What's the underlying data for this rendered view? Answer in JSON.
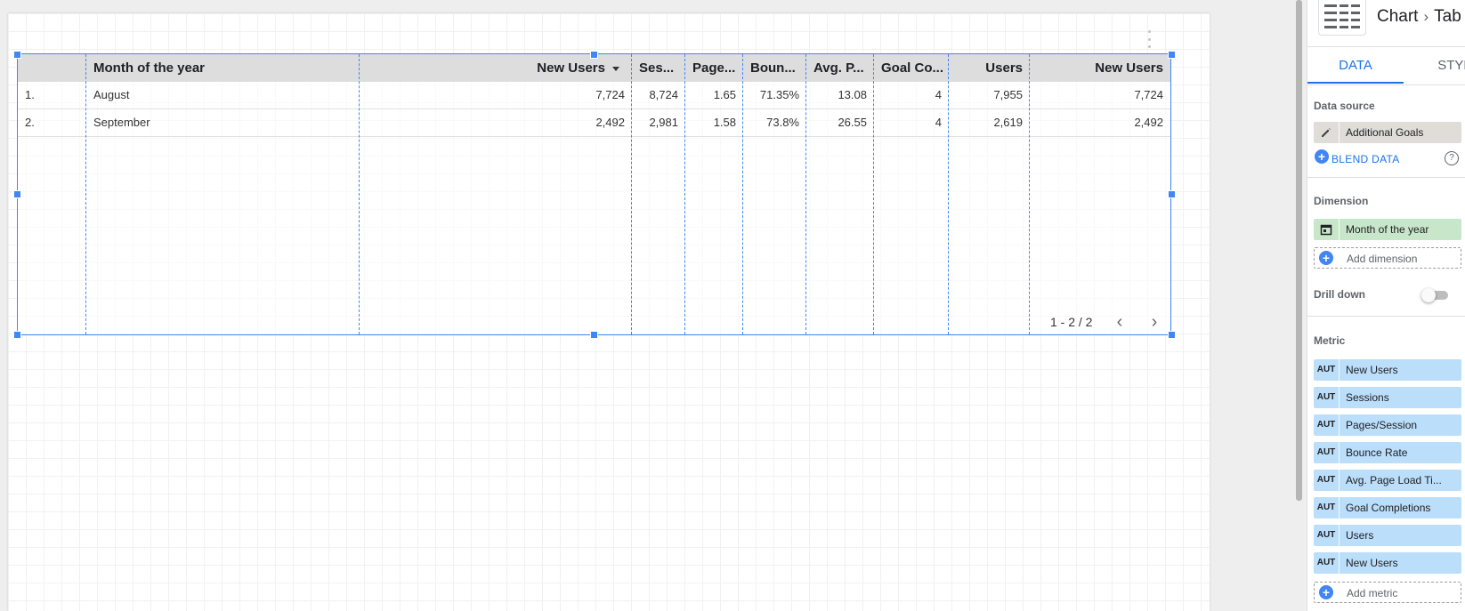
{
  "table": {
    "headers": [
      "",
      "Month of the year",
      "New Users",
      "Ses...",
      "Page...",
      "Boun...",
      "Avg. P...",
      "Goal Co...",
      "Users",
      "New Users"
    ],
    "rows": [
      [
        "1.",
        "August",
        "7,724",
        "8,724",
        "1.65",
        "71.35%",
        "13.08",
        "4",
        "7,955",
        "7,724"
      ],
      [
        "2.",
        "September",
        "2,492",
        "2,981",
        "1.58",
        "73.8%",
        "26.55",
        "4",
        "2,619",
        "2,492"
      ]
    ],
    "pager": "1 - 2 / 2",
    "pager_prev": "‹",
    "pager_next": "›"
  },
  "panel": {
    "crumb_chart": "Chart",
    "crumb_sep": "›",
    "crumb_type": "Tab",
    "tabs": [
      "DATA",
      "STYLE"
    ],
    "data_source_label": "Data source",
    "data_source_name": "Additional Goals",
    "blend_data": "BLEND DATA",
    "help": "?",
    "dimension_label": "Dimension",
    "dimension": "Month of the year",
    "add_dimension": "Add dimension",
    "drill_down_label": "Drill down",
    "drill_down_on": false,
    "metric_label": "Metric",
    "metric_tag": "AUT",
    "metrics": [
      "New Users",
      "Sessions",
      "Pages/Session",
      "Bounce Rate",
      "Avg. Page Load Ti...",
      "Goal Completions",
      "Users",
      "New Users"
    ],
    "add_metric": "Add metric",
    "plus": "+"
  },
  "colors": {
    "accent": "#1a73e8",
    "selection": "#4285f4",
    "dimension_chip": "#c8e6c9",
    "metric_chip": "#bbdefb"
  }
}
